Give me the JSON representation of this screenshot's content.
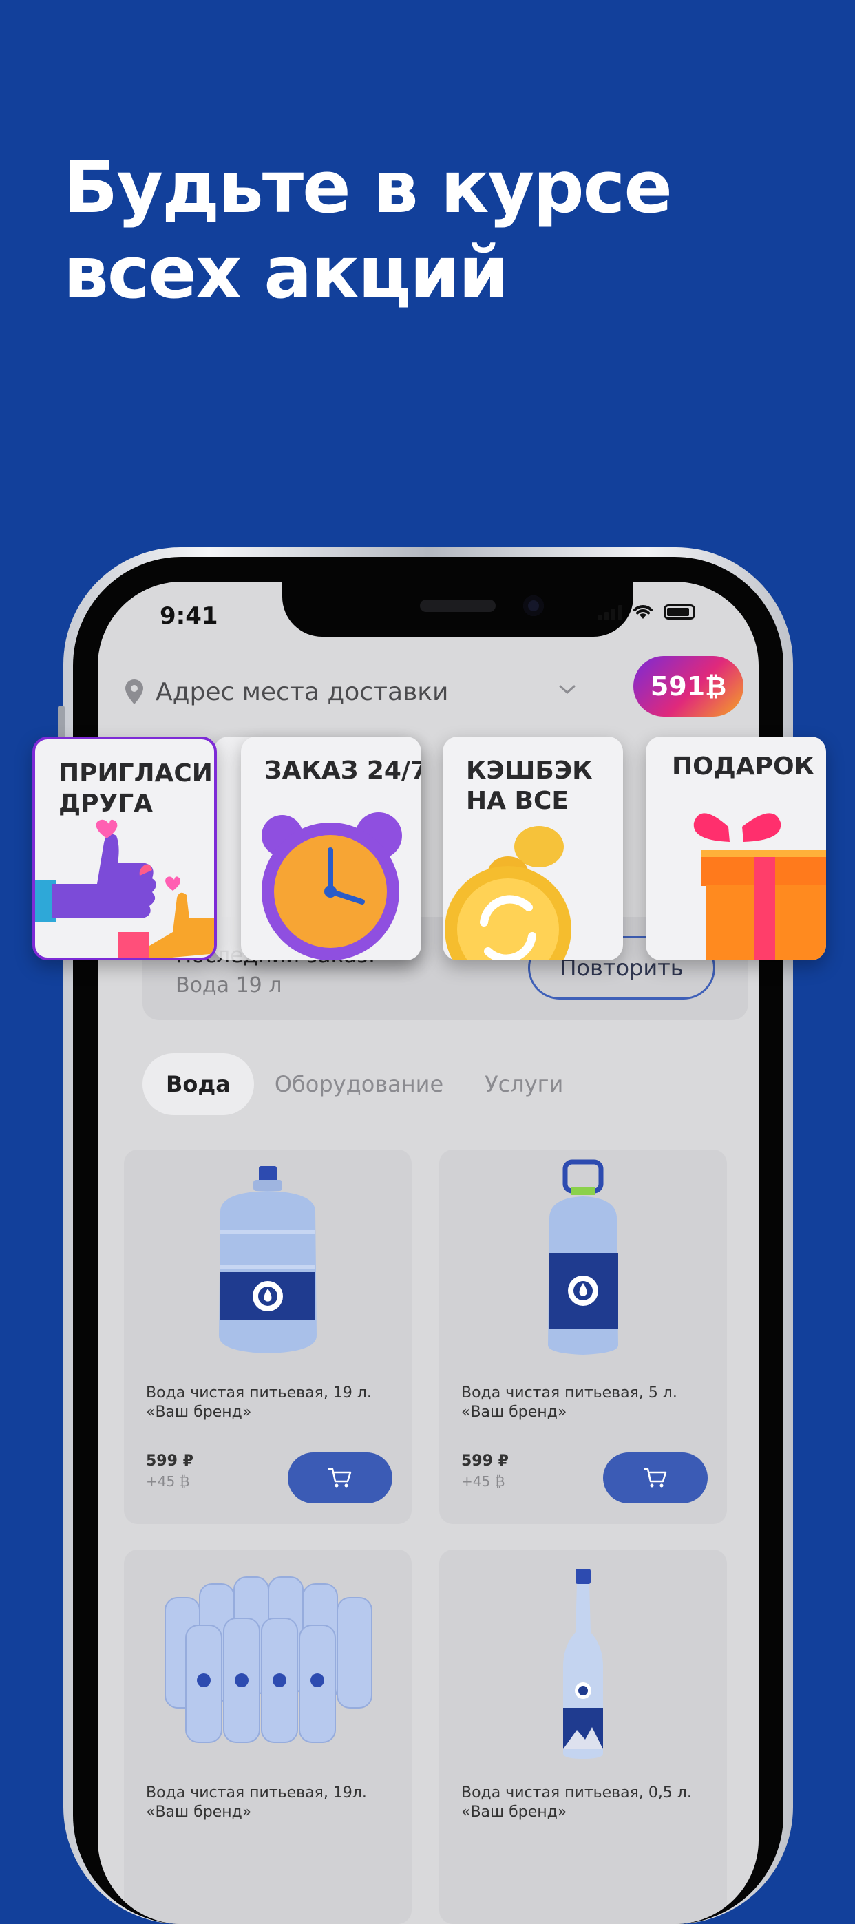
{
  "headline": {
    "line1": "Будьте в курсе",
    "line2": "всех акций"
  },
  "status_bar": {
    "time": "9:41"
  },
  "address": {
    "placeholder": "Адрес места доставки"
  },
  "coins": {
    "balance": "591₿"
  },
  "promos": [
    {
      "label": "ПРИГЛАСИ ДРУГА"
    },
    {
      "label": "ЗАКАЗ 24/7"
    },
    {
      "label": "КЭШБЭК НА ВСЕ"
    },
    {
      "label": "ПОДАРОК"
    }
  ],
  "last_order": {
    "title": "Последний заказ:",
    "item": "Вода 19 л",
    "repeat_label": "Повторить"
  },
  "tabs": [
    {
      "label": "Вода",
      "active": true
    },
    {
      "label": "Оборудование",
      "active": false
    },
    {
      "label": "Услуги",
      "active": false
    }
  ],
  "products": [
    {
      "name": "Вода чистая питьевая, 19 л. «Ваш бренд»",
      "price": "599 ₽",
      "bonus": "+45 ₿"
    },
    {
      "name": "Вода чистая питьевая, 5 л. «Ваш бренд»",
      "price": "599 ₽",
      "bonus": "+45 ₿"
    },
    {
      "name": "Вода чистая питьевая, 19л. «Ваш бренд»",
      "price": "",
      "bonus": ""
    },
    {
      "name": "Вода чистая питьевая, 0,5 л. «Ваш бренд»",
      "price": "",
      "bonus": ""
    }
  ],
  "colors": {
    "background": "#12409b",
    "accent": "#3b5bb5",
    "screen": "#d9d9db"
  }
}
